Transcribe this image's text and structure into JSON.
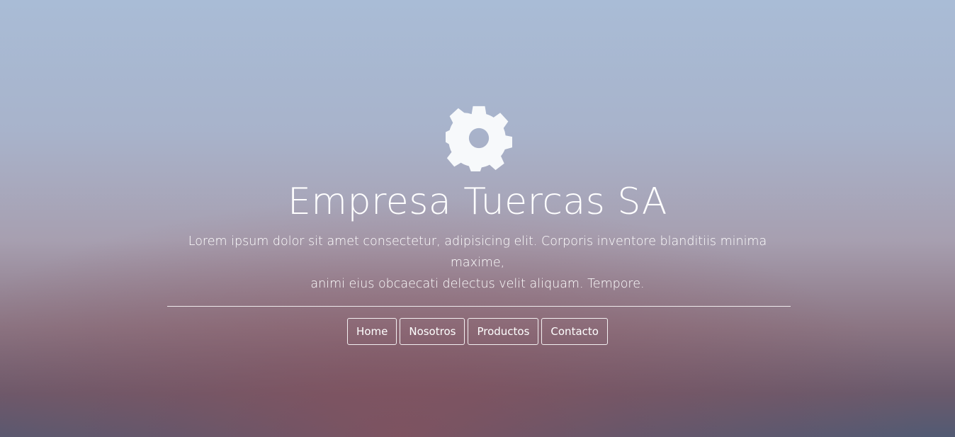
{
  "hero": {
    "logo_icon": "gear-icon",
    "title": "Empresa Tuercas SA",
    "subtitle_line1": "Lorem ipsum dolor sit amet consectetur, adipisicing elit. Corporis inventore blanditiis minima maxime,",
    "subtitle_line2": "animi eius obcaecati delectus velit aliquam. Tempore."
  },
  "nav": {
    "items": [
      {
        "label": "Home"
      },
      {
        "label": "Nosotros"
      },
      {
        "label": "Productos"
      },
      {
        "label": "Contacto"
      }
    ]
  },
  "colors": {
    "text": "#ffffff",
    "icon": "#f7f9fb",
    "sky_top": "#a9bcd6",
    "glow": "#8c505a",
    "bottom": "#525a73"
  }
}
